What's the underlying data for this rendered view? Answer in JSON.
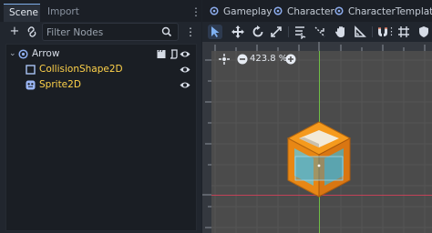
{
  "scene_dock": {
    "tabs": [
      {
        "label": "Scene",
        "active": true
      },
      {
        "label": "Import",
        "active": false
      }
    ],
    "filter": {
      "placeholder": "Filter Nodes",
      "value": ""
    },
    "tree": [
      {
        "name": "Arrow",
        "type": "Node2D",
        "depth": 0,
        "expanded": true,
        "icon": "node2d-icon"
      },
      {
        "name": "CollisionShape2D",
        "type": "CollisionShape2D",
        "depth": 1,
        "icon": "collision-shape-icon"
      },
      {
        "name": "Sprite2D",
        "type": "Sprite2D",
        "depth": 1,
        "icon": "sprite-icon"
      }
    ]
  },
  "main_tabs": [
    {
      "label": "Gameplay"
    },
    {
      "label": "Character"
    },
    {
      "label": "CharacterTemplate"
    }
  ],
  "viewport": {
    "zoom_label": "423.8 %"
  },
  "colors": {
    "accent": "#7faee8",
    "node_yellow": "#ffd24a",
    "axis_green": "#7acb4f",
    "axis_red": "#d0485c",
    "viewport_bg": "#4b4b4b"
  }
}
